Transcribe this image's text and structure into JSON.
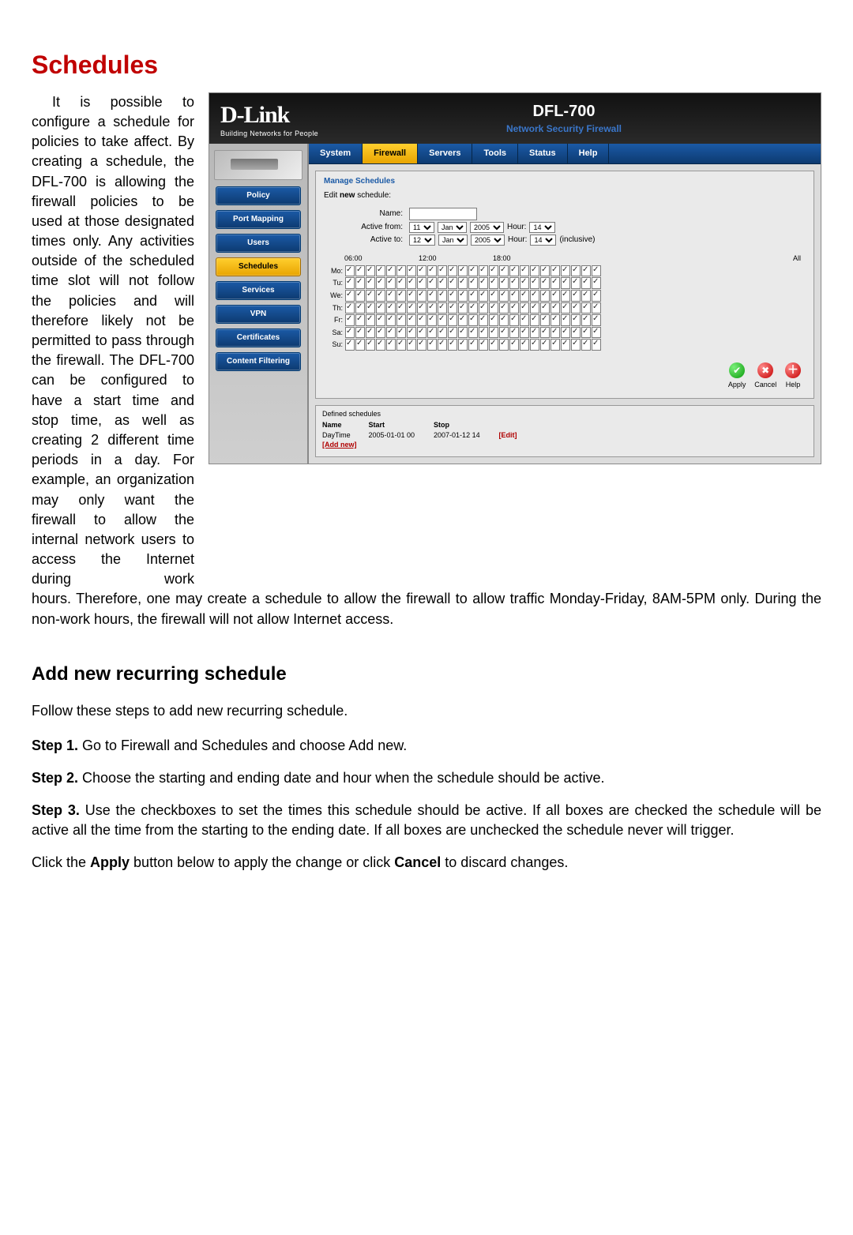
{
  "page": {
    "title": "Schedules",
    "intro": "It is possible to configure a schedule for policies to take affect. By creating a schedule, the DFL-700 is allowing the firewall policies to be used at those designated times only. Any activities outside of the scheduled time slot will not follow the policies and will therefore likely not be permitted to pass through the firewall. The DFL-700 can be configured to have a start time and stop time, as well as creating 2 different time periods in a day. For example, an organization may only want the firewall to allow the internal network users to access the Internet during work",
    "intro_cont": "hours. Therefore, one may create a schedule to allow the firewall to allow traffic Monday-Friday, 8AM-5PM only. During the non-work hours, the firewall will not allow Internet access.",
    "sub_title": "Add new recurring schedule",
    "sub_lead": "Follow these steps to add new recurring schedule.",
    "steps": [
      {
        "label": "Step 1.",
        "text": " Go to Firewall and Schedules and choose Add new."
      },
      {
        "label": "Step 2.",
        "text": " Choose the starting and ending date and hour when the schedule should be active."
      },
      {
        "label": "Step 3.",
        "text": " Use the checkboxes to set the times this schedule should be active. If all boxes are checked the schedule will be active all the time from the starting to the ending date. If all boxes are unchecked the schedule never will trigger."
      }
    ],
    "apply_note_pre": "Click the ",
    "apply_note_b1": "Apply",
    "apply_note_mid": " button below to apply the change or click ",
    "apply_note_b2": "Cancel",
    "apply_note_post": " to discard changes."
  },
  "shot": {
    "brand": "D-Link",
    "brand_tag": "Building Networks for People",
    "model": "DFL-700",
    "model_sub": "Network Security Firewall",
    "top_tabs": [
      "System",
      "Firewall",
      "Servers",
      "Tools",
      "Status",
      "Help"
    ],
    "active_top_tab": "Firewall",
    "side_items": [
      "Policy",
      "Port Mapping",
      "Users",
      "Schedules",
      "Services",
      "VPN",
      "Certificates",
      "Content Filtering"
    ],
    "active_side": "Schedules",
    "panel_title": "Manage Schedules",
    "panel_sub_pre": "Edit ",
    "panel_sub_b": "new",
    "panel_sub_post": " schedule:",
    "labels": {
      "name": "Name:",
      "active_from": "Active from:",
      "active_to": "Active to:",
      "hour": "Hour:",
      "inclusive": "(inclusive)"
    },
    "from": {
      "day": "11",
      "month": "Jan",
      "year": "2005",
      "hour": "14"
    },
    "to": {
      "day": "12",
      "month": "Jan",
      "year": "2005",
      "hour": "14"
    },
    "time_headers": [
      "06:00",
      "12:00",
      "18:00",
      "All"
    ],
    "days": [
      "Mo:",
      "Tu:",
      "We:",
      "Th:",
      "Fr:",
      "Sa:",
      "Su:"
    ],
    "hours_per_day": 25,
    "actions": {
      "apply": "Apply",
      "cancel": "Cancel",
      "help": "Help"
    },
    "defined": {
      "title": "Defined schedules",
      "cols": {
        "name": "Name",
        "start": "Start",
        "stop": "Stop"
      },
      "rows": [
        {
          "name": "DayTime",
          "start": "2005-01-01 00",
          "stop": "2007-01-12 14",
          "edit": "[Edit]"
        }
      ],
      "add_new": "[Add new]"
    }
  }
}
